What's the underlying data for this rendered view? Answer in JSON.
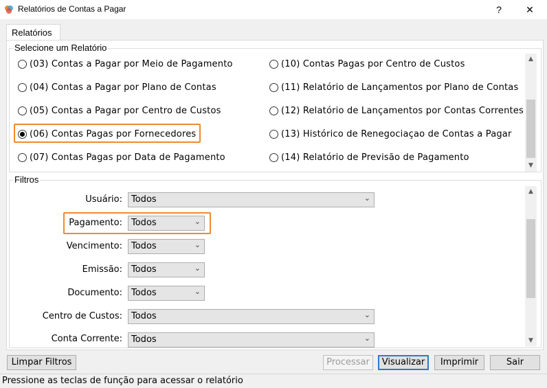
{
  "window": {
    "title": "Relatórios de Contas a Pagar",
    "help_label": "?",
    "close_label": "✕"
  },
  "tab": {
    "label": "Relatórios"
  },
  "reports_group": {
    "legend": "Selecione um Relatório",
    "left": [
      {
        "label": "(03) Contas a Pagar por Meio de Pagamento",
        "checked": false
      },
      {
        "label": "(04) Contas a Pagar por Plano de Contas",
        "checked": false
      },
      {
        "label": "(05) Contas a Pagar por Centro de Custos",
        "checked": false
      },
      {
        "label": "(06) Contas Pagas por Fornecedores",
        "checked": true
      },
      {
        "label": "(07) Contas Pagas por Data de Pagamento",
        "checked": false
      }
    ],
    "right": [
      {
        "label": "(10) Contas Pagas por Centro de Custos",
        "checked": false
      },
      {
        "label": "(11) Relatório de Lançamentos por Plano de Contas",
        "checked": false
      },
      {
        "label": "(12) Relatório de Lançamentos por Contas Correntes",
        "checked": false
      },
      {
        "label": "(13) Histórico de Renegociaçao de Contas a Pagar",
        "checked": false
      },
      {
        "label": "(14) Relatório de Previsão de Pagamento",
        "checked": false
      }
    ]
  },
  "filters_group": {
    "legend": "Filtros",
    "fields": [
      {
        "label": "Usuário:",
        "value": "Todos"
      },
      {
        "label": "Pagamento:",
        "value": "Todos"
      },
      {
        "label": "Vencimento:",
        "value": "Todos"
      },
      {
        "label": "Emissão:",
        "value": "Todos"
      },
      {
        "label": "Documento:",
        "value": "Todos"
      },
      {
        "label": "Centro de Custos:",
        "value": "Todos"
      },
      {
        "label": "Conta Corrente:",
        "value": "Todos"
      }
    ]
  },
  "buttons": {
    "clear": "Limpar Filtros",
    "process": "Processar",
    "view": "Visualizar",
    "print": "Imprimir",
    "exit": "Sair"
  },
  "status": {
    "text": "Pressione as teclas de função para acessar o relatório"
  },
  "colors": {
    "highlight": "#f08a2c",
    "default_button_border": "#2a7ad0"
  }
}
